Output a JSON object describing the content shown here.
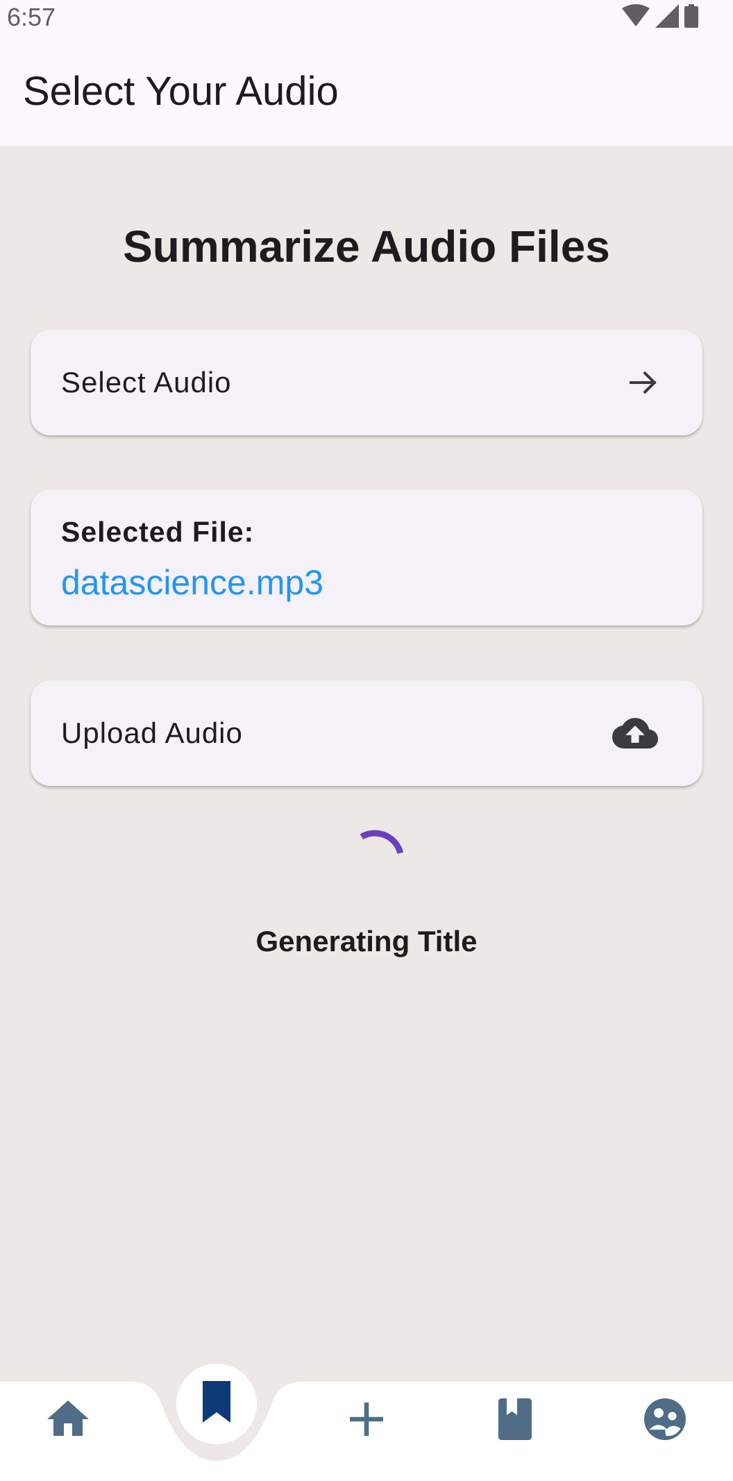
{
  "status_bar": {
    "time": "6:57"
  },
  "app_bar": {
    "title": "Select Your Audio"
  },
  "main": {
    "heading": "Summarize Audio Files",
    "select_audio": {
      "label": "Select Audio",
      "icon": "arrow-right-icon"
    },
    "selected_file": {
      "title": "Selected File:",
      "name": "datascience.mp3"
    },
    "upload_audio": {
      "label": "Upload Audio",
      "icon": "cloud-upload-icon"
    },
    "progress": {
      "text": "Generating Title"
    }
  },
  "bottom_nav": {
    "items": [
      {
        "icon": "home-icon"
      },
      {
        "icon": "bookmark-icon",
        "active": true
      },
      {
        "icon": "add-icon"
      },
      {
        "icon": "book-icon"
      },
      {
        "icon": "community-icon"
      }
    ]
  },
  "colors": {
    "background": "#ede7e5",
    "card": "#f4f1f8",
    "link": "#2196f3",
    "spinner": "#6a3fc1",
    "nav_icon": "#4f6d86",
    "nav_active": "#0e3a7a"
  }
}
